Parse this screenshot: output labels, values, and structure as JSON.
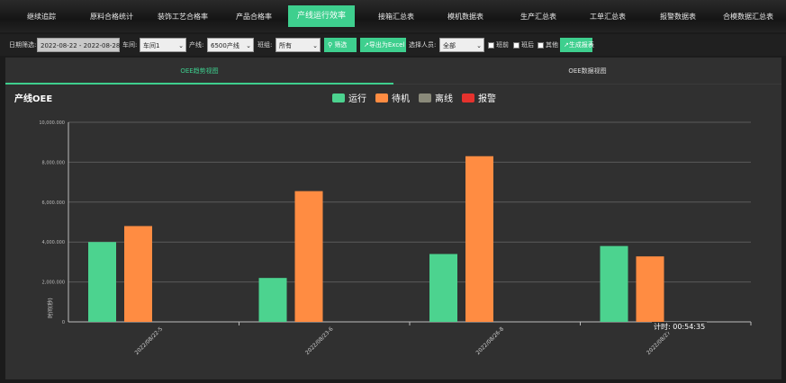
{
  "nav": {
    "items": [
      "继续追踪",
      "原料合格统计",
      "装饰工艺合格率",
      "产品合格率",
      "产线运行效率",
      "接箱汇总表",
      "模机数据表",
      "生产汇总表",
      "工单汇总表",
      "报警数据表",
      "合模数据汇总表"
    ],
    "active_index": 4
  },
  "toolbar": {
    "date_label": "日期筛选:",
    "date_range": "2022-08-22 - 2022-08-28",
    "workshop_label": "车间:",
    "workshop_value": "车间1",
    "line_label": "产线:",
    "line_value": "6500产线",
    "shift_label": "班组:",
    "shift_value": "所有",
    "filter_button": "筛选",
    "export_button": "导出为Excel",
    "person_label": "选择人员:",
    "person_value": "全部",
    "check1": "班前",
    "check2": "班后",
    "check3": "其他",
    "report_button": "生成报表"
  },
  "tabs": [
    "OEE趋势视图",
    "OEE数据视图"
  ],
  "chart_data": {
    "type": "bar",
    "title": "产线OEE",
    "categories": [
      "2022/08/22-5",
      "2022/08/23-6",
      "2022/08/26-8",
      "2022/08/27-9"
    ],
    "series": [
      {
        "name": "运行",
        "color": "#4cd38f",
        "values": [
          4000,
          2200,
          3400,
          3800
        ]
      },
      {
        "name": "待机",
        "color": "#ff8c42",
        "values": [
          4800,
          6550,
          8300,
          3280
        ]
      },
      {
        "name": "离线",
        "color": "#8a8a7a",
        "values": [
          0,
          0,
          0,
          0
        ]
      },
      {
        "name": "报警",
        "color": "#e5322d",
        "values": [
          0,
          0,
          0,
          0
        ]
      }
    ],
    "ylim": [
      0,
      10000
    ],
    "yticks": [
      "0",
      "2,000.000",
      "4,000.000",
      "6,000.000",
      "8,000.000",
      "10,000.000"
    ],
    "ylabel": "时间(秒)",
    "grid": true,
    "legend_position": "top-center"
  },
  "timer": "计时: 00:54:35"
}
